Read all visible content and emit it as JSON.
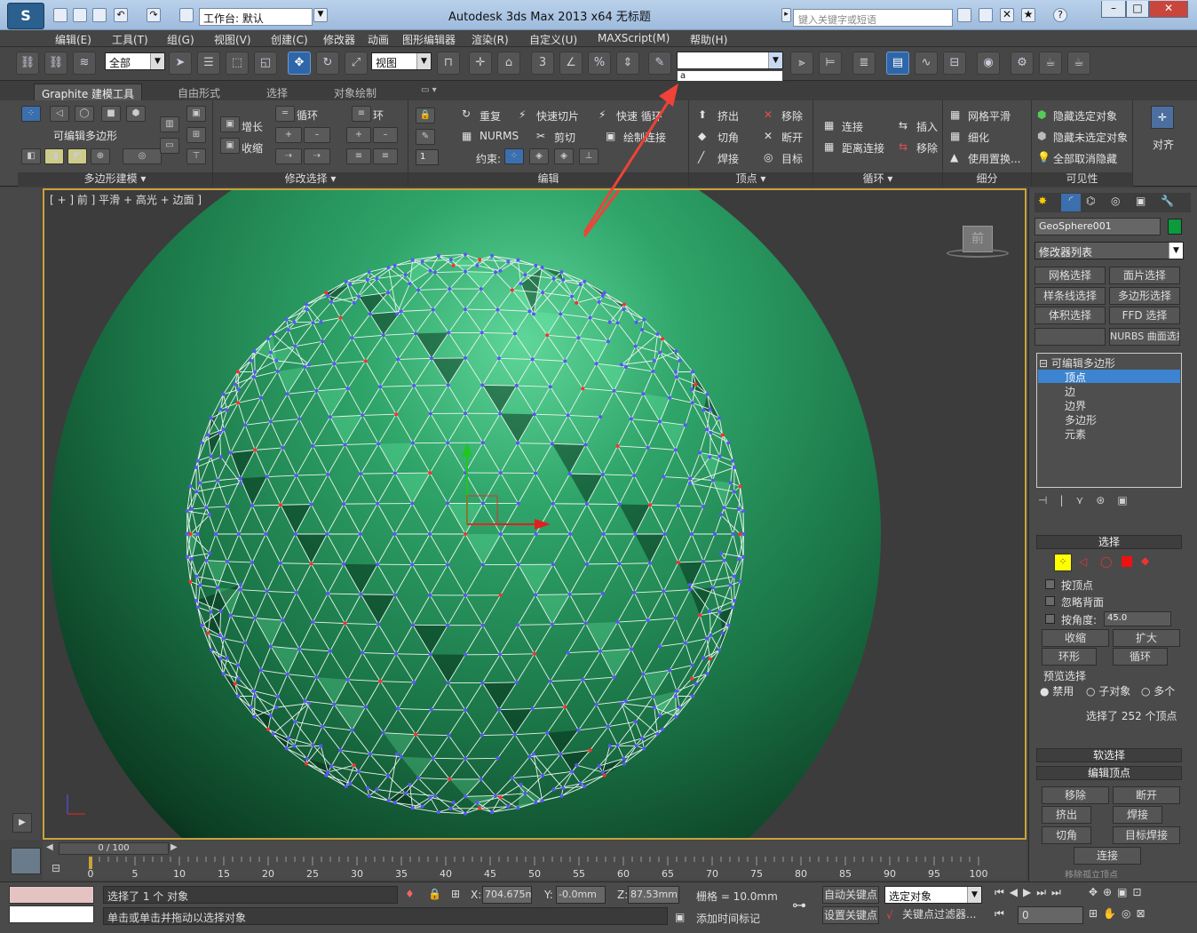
{
  "titlebar": {
    "title": "Autodesk 3ds Max  2013 x64        无标题",
    "workspace_label": "工作台: 默认",
    "search_placeholder": "键入关键字或短语"
  },
  "menu": [
    "编辑(E)",
    "工具(T)",
    "组(G)",
    "视图(V)",
    "创建(C)",
    "修改器",
    "动画",
    "图形编辑器",
    "渲染(R)",
    "自定义(U)",
    "MAXScript(M)",
    "帮助(H)"
  ],
  "toolbar": {
    "selection_filter": "全部",
    "ref_coord": "视图",
    "named_selection_value": "",
    "named_selection_dropdown_item": "a"
  },
  "ribbon_tabs": [
    "Graphite 建模工具",
    "自由形式",
    "选择",
    "对象绘制"
  ],
  "ribbon": {
    "polygon_modeling": {
      "mode_label": "可编辑多边形",
      "group_label": "多边形建模"
    },
    "modify_selection": {
      "grow": "增长",
      "shrink": "收缩",
      "loop": "循环",
      "ring": "环",
      "group_label": "修改选择"
    },
    "edit": {
      "repeat": "重复",
      "quickslice": "快速切片",
      "quickloop": "快速 循环",
      "nurms": "NURMS",
      "cut": "剪切",
      "swiftloop": "绘制连接",
      "constraint": "约束:",
      "spin_value": "1",
      "group_label": "编辑"
    },
    "vertices": {
      "extrude": "挤出",
      "remove": "移除",
      "chamfer": "切角",
      "break": "断开",
      "weld": "焊接",
      "target": "目标",
      "group_label": "顶点"
    },
    "loops": {
      "connect": "连接",
      "insert": "插入",
      "distance_connect": "距离连接",
      "remove": "移除",
      "group_label": "循环"
    },
    "subdivision": {
      "meshsmooth": "网格平滑",
      "tessellate": "细化",
      "use_displacement": "使用置换...",
      "group_label": "细分"
    },
    "visibility": {
      "hide_selected": "隐藏选定对象",
      "hide_unselected": "隐藏未选定对象",
      "unhide_all": "全部取消隐藏",
      "group_label": "可见性"
    },
    "align": {
      "label": "对齐"
    }
  },
  "viewport": {
    "label": "[ + ] 前 ] 平滑 + 高光 + 边面 ]",
    "viewcube_face": "前",
    "sphere_color": "#1f7a4e",
    "selected_vertex_color": "#ff3030",
    "vertex_color": "#5a55ff"
  },
  "command_panel": {
    "object_name": "GeoSphere001",
    "object_color": "#0b9a3c",
    "modifier_list": "修改器列表",
    "quick_buttons": [
      "网格选择",
      "面片选择",
      "样条线选择",
      "多边形选择",
      "体积选择",
      "FFD 选择",
      "",
      "NURBS 曲面选择"
    ],
    "stack": {
      "root": "可编辑多边形",
      "items": [
        "顶点",
        "边",
        "边界",
        "多边形",
        "元素"
      ],
      "selected_index": 0
    },
    "selection": {
      "title": "选择",
      "by_vertex": "按顶点",
      "ignore_backfacing": "忽略背面",
      "by_angle": "按角度:",
      "angle_value": "45.0",
      "shrink": "收缩",
      "grow": "扩大",
      "ring": "环形",
      "loop": "循环",
      "preview_title": "预览选择",
      "preview_off": "禁用",
      "preview_sub": "子对象",
      "preview_multi": "多个",
      "status": "选择了 252 个顶点"
    },
    "soft_selection": "软选择",
    "edit_vertices": {
      "title": "编辑顶点",
      "remove": "移除",
      "break": "断开",
      "extrude": "挤出",
      "weld": "焊接",
      "chamfer": "切角",
      "target_weld": "目标焊接",
      "connect": "连接",
      "more": "移除孤立顶点"
    }
  },
  "timeline": {
    "frame": "0 / 100",
    "ticks": [
      "0",
      "5",
      "10",
      "15",
      "20",
      "25",
      "30",
      "35",
      "40",
      "45",
      "50",
      "55",
      "60",
      "65",
      "70",
      "75",
      "80",
      "85",
      "90",
      "95",
      "100"
    ]
  },
  "status": {
    "selection_msg": "选择了 1 个 对象",
    "prompt": "单击或单击并拖动以选择对象",
    "x_label": "X:",
    "x_value": "704.675mm",
    "y_label": "Y:",
    "y_value": "-0.0mm",
    "z_label": "Z:",
    "z_value": "87.53mm",
    "grid": "栅格 = 10.0mm",
    "add_time_tag": "添加时间标记",
    "auto_key": "自动关键点",
    "set_key": "设置关键点",
    "selected_object": "选定对象",
    "key_filters": "关键点过滤器...",
    "frame_field": "0"
  }
}
